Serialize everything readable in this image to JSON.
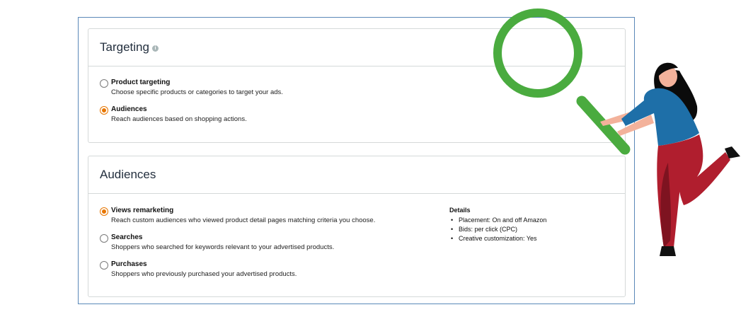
{
  "targeting": {
    "title": "Targeting",
    "info_icon": "i",
    "options": [
      {
        "label": "Product targeting",
        "description": "Choose specific products or categories to target your ads.",
        "selected": false
      },
      {
        "label": "Audiences",
        "description": "Reach audiences based on shopping actions.",
        "selected": true
      }
    ]
  },
  "audiences": {
    "title": "Audiences",
    "options": [
      {
        "label": "Views remarketing",
        "description": "Reach custom audiences who viewed product detail pages matching criteria you choose.",
        "selected": true
      },
      {
        "label": "Searches",
        "description": "Shoppers who searched for keywords relevant to your advertised products.",
        "selected": false
      },
      {
        "label": "Purchases",
        "description": "Shoppers who previously purchased your advertised products.",
        "selected": false
      }
    ],
    "details": {
      "title": "Details",
      "items": [
        "Placement: On and off Amazon",
        "Bids: per click (CPC)",
        "Creative customization: Yes"
      ]
    }
  },
  "colors": {
    "radio_selected": "#e77600",
    "frame_border": "#5a88b8",
    "magnifier": "#4aab3f",
    "jacket": "#1e6fa8",
    "pants": "#b01e2e"
  },
  "icons": [
    "info-icon",
    "magnifying-glass-icon"
  ]
}
